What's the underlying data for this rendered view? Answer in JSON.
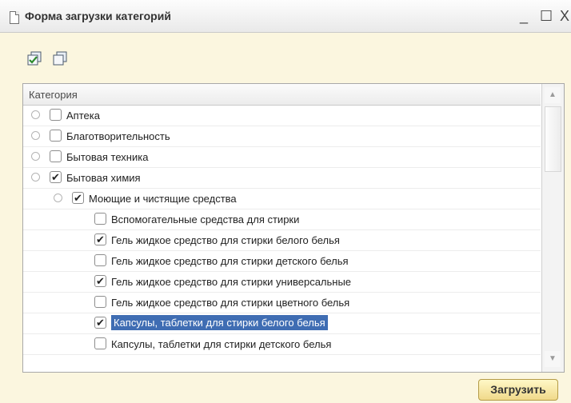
{
  "window": {
    "title": "Форма загрузки категорий",
    "minimize": "_",
    "maximize": "☐",
    "close": "X"
  },
  "toolbar": {
    "buttons": [
      {
        "name": "check-all",
        "icon": "check-all-icon"
      },
      {
        "name": "uncheck-all",
        "icon": "uncheck-all-icon"
      }
    ]
  },
  "grid": {
    "column_header": "Категория",
    "rows": [
      {
        "label": "Аптека",
        "checked": false,
        "expander": "⊕",
        "level": 0
      },
      {
        "label": "Благотворительность",
        "checked": false,
        "expander": "⊕",
        "level": 0
      },
      {
        "label": "Бытовая техника",
        "checked": false,
        "expander": "⊕",
        "level": 0
      },
      {
        "label": "Бытовая химия",
        "checked": true,
        "expander": "⊖",
        "level": 0
      },
      {
        "label": "Моющие и чистящие средства",
        "checked": true,
        "expander": "⊖",
        "level": 1
      },
      {
        "label": "Вспомогательные средства для стирки",
        "checked": false,
        "expander": "",
        "level": 2
      },
      {
        "label": "Гель жидкое средство для стирки белого белья",
        "checked": true,
        "expander": "",
        "level": 2
      },
      {
        "label": "Гель жидкое средство для стирки детского белья",
        "checked": false,
        "expander": "",
        "level": 2
      },
      {
        "label": "Гель жидкое средство для стирки универсальные",
        "checked": true,
        "expander": "",
        "level": 2
      },
      {
        "label": "Гель жидкое средство для стирки цветного белья",
        "checked": false,
        "expander": "",
        "level": 2
      },
      {
        "label": "Капсулы, таблетки для стирки белого белья",
        "checked": true,
        "expander": "",
        "level": 2,
        "selected": true
      },
      {
        "label": "Капсулы, таблетки для стирки детского белья",
        "checked": false,
        "expander": "",
        "level": 2
      }
    ]
  },
  "check_mark": "✔",
  "load_button": "Загрузить",
  "colors": {
    "window_bg": "#fbf6df",
    "selection": "#3f6db3",
    "button_bg": "#f0d98a"
  }
}
